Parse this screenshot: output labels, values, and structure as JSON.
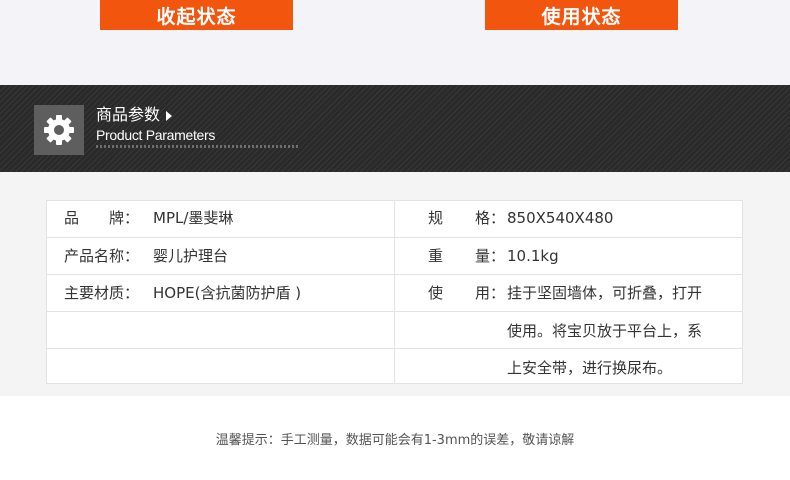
{
  "states": {
    "folded_label": "收起状态",
    "in_use_label": "使用状态"
  },
  "banner": {
    "title": "商品参数",
    "subtitle": "Product Parameters",
    "icon": "gear-icon",
    "colors": {
      "background": "#2a2a2a",
      "icon_box": "#5e5e5e",
      "accent": "#f2550e"
    }
  },
  "params": {
    "brand": {
      "label_chars": [
        "品",
        "牌"
      ],
      "colon": "：",
      "value": "MPL/墨斐琳"
    },
    "product_name": {
      "label": "产品名称：",
      "value": "婴儿护理台"
    },
    "material": {
      "label": "主要材质：",
      "value": "HOPE(含抗菌防护盾 )"
    },
    "spec": {
      "label_chars": [
        "规",
        "格"
      ],
      "colon": "：",
      "value": "850X540X480"
    },
    "weight": {
      "label_chars": [
        "重",
        "量"
      ],
      "colon": "：",
      "value": "10.1kg"
    },
    "usage": {
      "label_chars": [
        "使",
        "用"
      ],
      "colon": "：",
      "lines": [
        "挂于坚固墙体，可折叠，打开",
        "使用。将宝贝放于平台上，系",
        "上安全带，进行换尿布。"
      ]
    }
  },
  "footer": {
    "note": "温馨提示：手工测量，数据可能会有1-3mm的误差，敬请谅解"
  }
}
